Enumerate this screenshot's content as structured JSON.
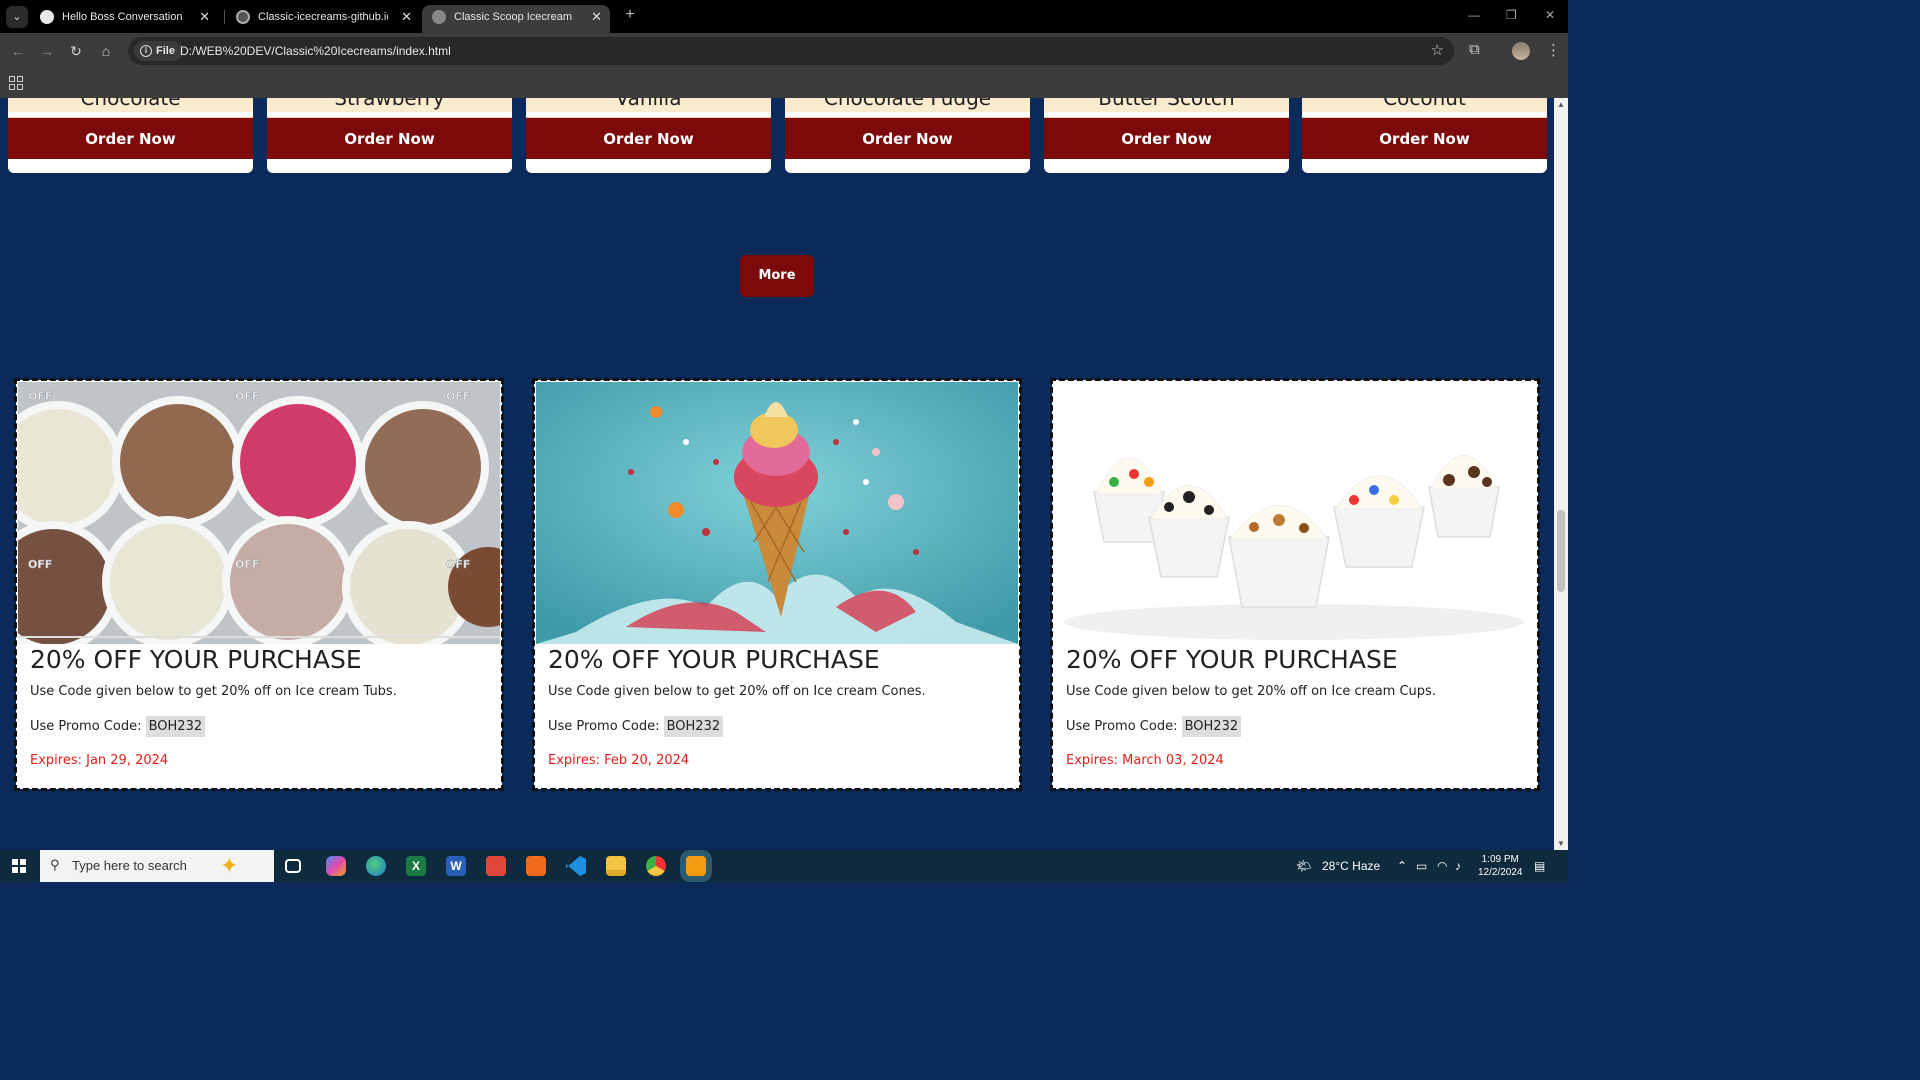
{
  "browser": {
    "tabs": [
      {
        "title": "Hello Boss Conversation",
        "active": false
      },
      {
        "title": "Classic-icecreams-github.io/README.md",
        "active": false
      },
      {
        "title": "Classic Scoop Icecream",
        "active": true
      }
    ],
    "omnibox_chip": "File",
    "url": "D:/WEB%20DEV/Classic%20Icecreams/index.html"
  },
  "flavors": [
    {
      "name": "Chocolate",
      "button": "Order Now"
    },
    {
      "name": "Strawberry",
      "button": "Order Now"
    },
    {
      "name": "Vanilla",
      "button": "Order Now"
    },
    {
      "name": "Chocolate Fudge",
      "button": "Order Now"
    },
    {
      "name": "Butter Scotch",
      "button": "Order Now"
    },
    {
      "name": "Coconut",
      "button": "Order Now"
    }
  ],
  "more_label": "More",
  "coupons": [
    {
      "title": "20% OFF YOUR PURCHASE",
      "desc": "Use Code given below to get 20% off on Ice cream Tubs.",
      "promo_label": "Use Promo Code:",
      "code": "BOH232",
      "expires": "Expires: Jan 29, 2024"
    },
    {
      "title": "20% OFF YOUR PURCHASE",
      "desc": "Use Code given below to get 20% off on Ice cream Cones.",
      "promo_label": "Use Promo Code:",
      "code": "BOH232",
      "expires": "Expires: Feb 20, 2024"
    },
    {
      "title": "20% OFF YOUR PURCHASE",
      "desc": "Use Code given below to get 20% off on Ice cream Cups.",
      "promo_label": "Use Promo Code:",
      "code": "BOH232",
      "expires": "Expires: March 03, 2024"
    }
  ],
  "taskbar": {
    "search_placeholder": "Type here to search",
    "weather": "28°C  Haze",
    "time": "1:09 PM",
    "date": "12/2/2024"
  },
  "colors": {
    "page_bg": "#0b2a5a",
    "button_red": "#7c0a0a",
    "expires_red": "#e0201a",
    "flavor_band": "#fdebd0"
  }
}
